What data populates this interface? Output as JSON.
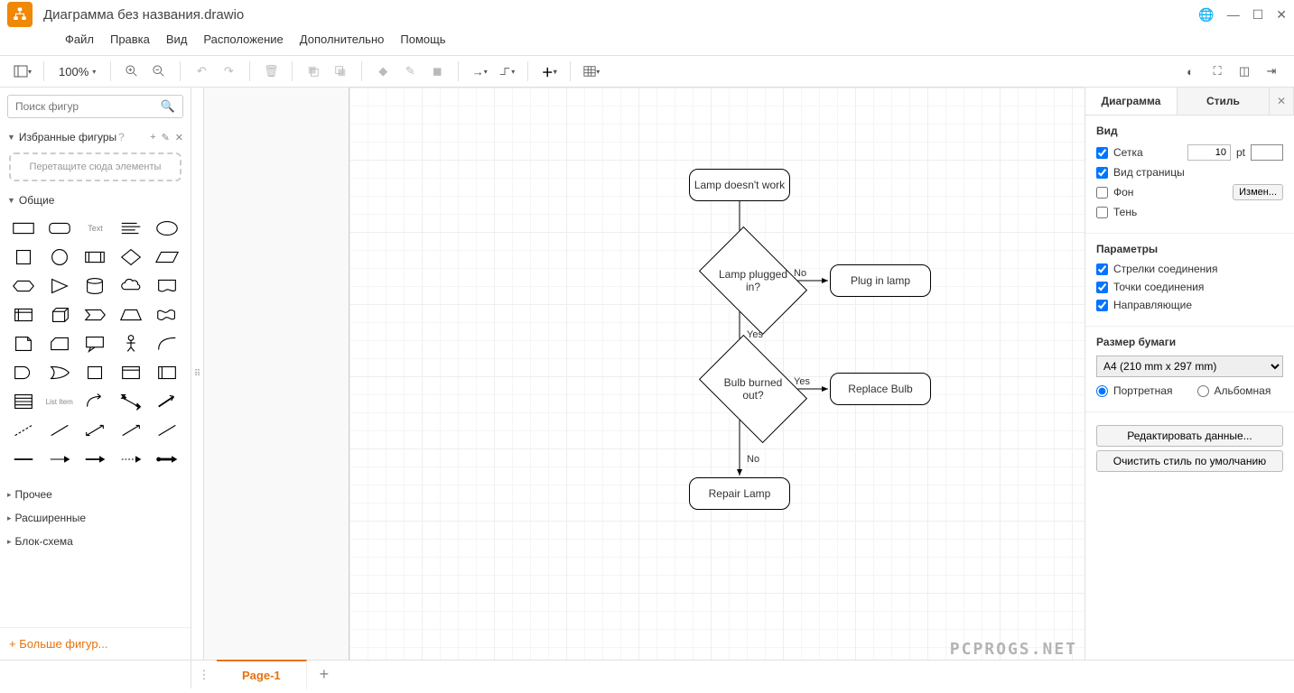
{
  "title": "Диаграмма без названия.drawio",
  "menubar": [
    "Файл",
    "Правка",
    "Вид",
    "Расположение",
    "Дополнительно",
    "Помощь"
  ],
  "toolbar": {
    "zoom": "100%"
  },
  "sidebar": {
    "search_placeholder": "Поиск фигур",
    "favorites_label": "Избранные фигуры",
    "favorites_hint": "?",
    "scratch_hint": "Перетащите сюда элементы",
    "sections": {
      "general": "Общие",
      "misc": "Прочее",
      "advanced": "Расширенные",
      "flowchart": "Блок-схема"
    },
    "more_shapes": "+ Больше фигур..."
  },
  "flow": {
    "start": "Lamp doesn't work",
    "d1": "Lamp plugged in?",
    "d1_no": "No",
    "d1_yes": "Yes",
    "a1": "Plug in lamp",
    "d2": "Bulb burned out?",
    "d2_yes": "Yes",
    "d2_no": "No",
    "a2": "Replace Bulb",
    "end": "Repair Lamp"
  },
  "right": {
    "tab_diagram": "Диаграмма",
    "tab_style": "Стиль",
    "view_h": "Вид",
    "grid": "Сетка",
    "grid_val": "10",
    "grid_unit": "pt",
    "page_view": "Вид страницы",
    "background": "Фон",
    "change": "Измен...",
    "shadow": "Тень",
    "params_h": "Параметры",
    "conn_arrows": "Стрелки соединения",
    "conn_points": "Точки соединения",
    "guides": "Направляющие",
    "paper_h": "Размер бумаги",
    "paper_size": "A4 (210 mm x 297 mm)",
    "portrait": "Портретная",
    "landscape": "Альбомная",
    "edit_data": "Редактировать данные...",
    "clear_style": "Очистить стиль по умолчанию"
  },
  "footer": {
    "page1": "Page-1"
  },
  "watermark": "PCPROGS.NET"
}
